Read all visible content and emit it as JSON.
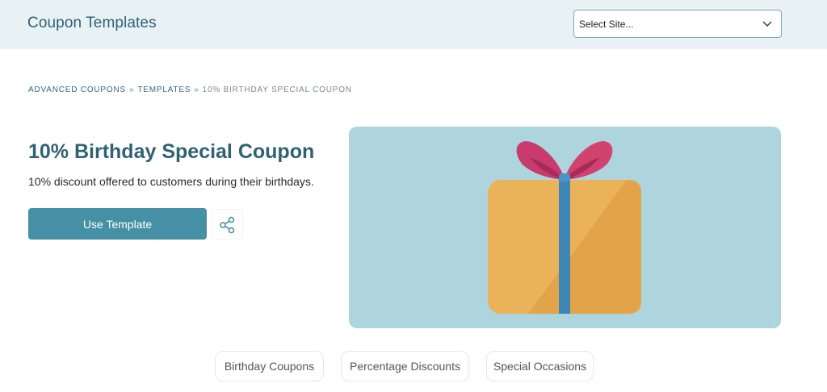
{
  "header": {
    "title": "Coupon Templates",
    "site_select": {
      "selected": "Select Site..."
    }
  },
  "breadcrumb": {
    "items": [
      "ADVANCED COUPONS",
      "TEMPLATES",
      "10% BIRTHDAY SPECIAL COUPON"
    ],
    "separator": "»"
  },
  "coupon": {
    "title": "10% Birthday Special Coupon",
    "description": "10% discount offered to customers during their birthdays.",
    "use_template_label": "Use Template",
    "hero_icon": "gift-icon"
  },
  "tags": [
    "Birthday Coupons",
    "Percentage Discounts",
    "Special Occasions"
  ],
  "colors": {
    "header_bg": "#e8f1f4",
    "accent": "#4690a5",
    "title": "#2f6272",
    "hero_bg": "#aed5dd",
    "gift_box": "#eab35a",
    "gift_ribbon": "#3f86b8",
    "gift_bow": "#c83b6c"
  }
}
